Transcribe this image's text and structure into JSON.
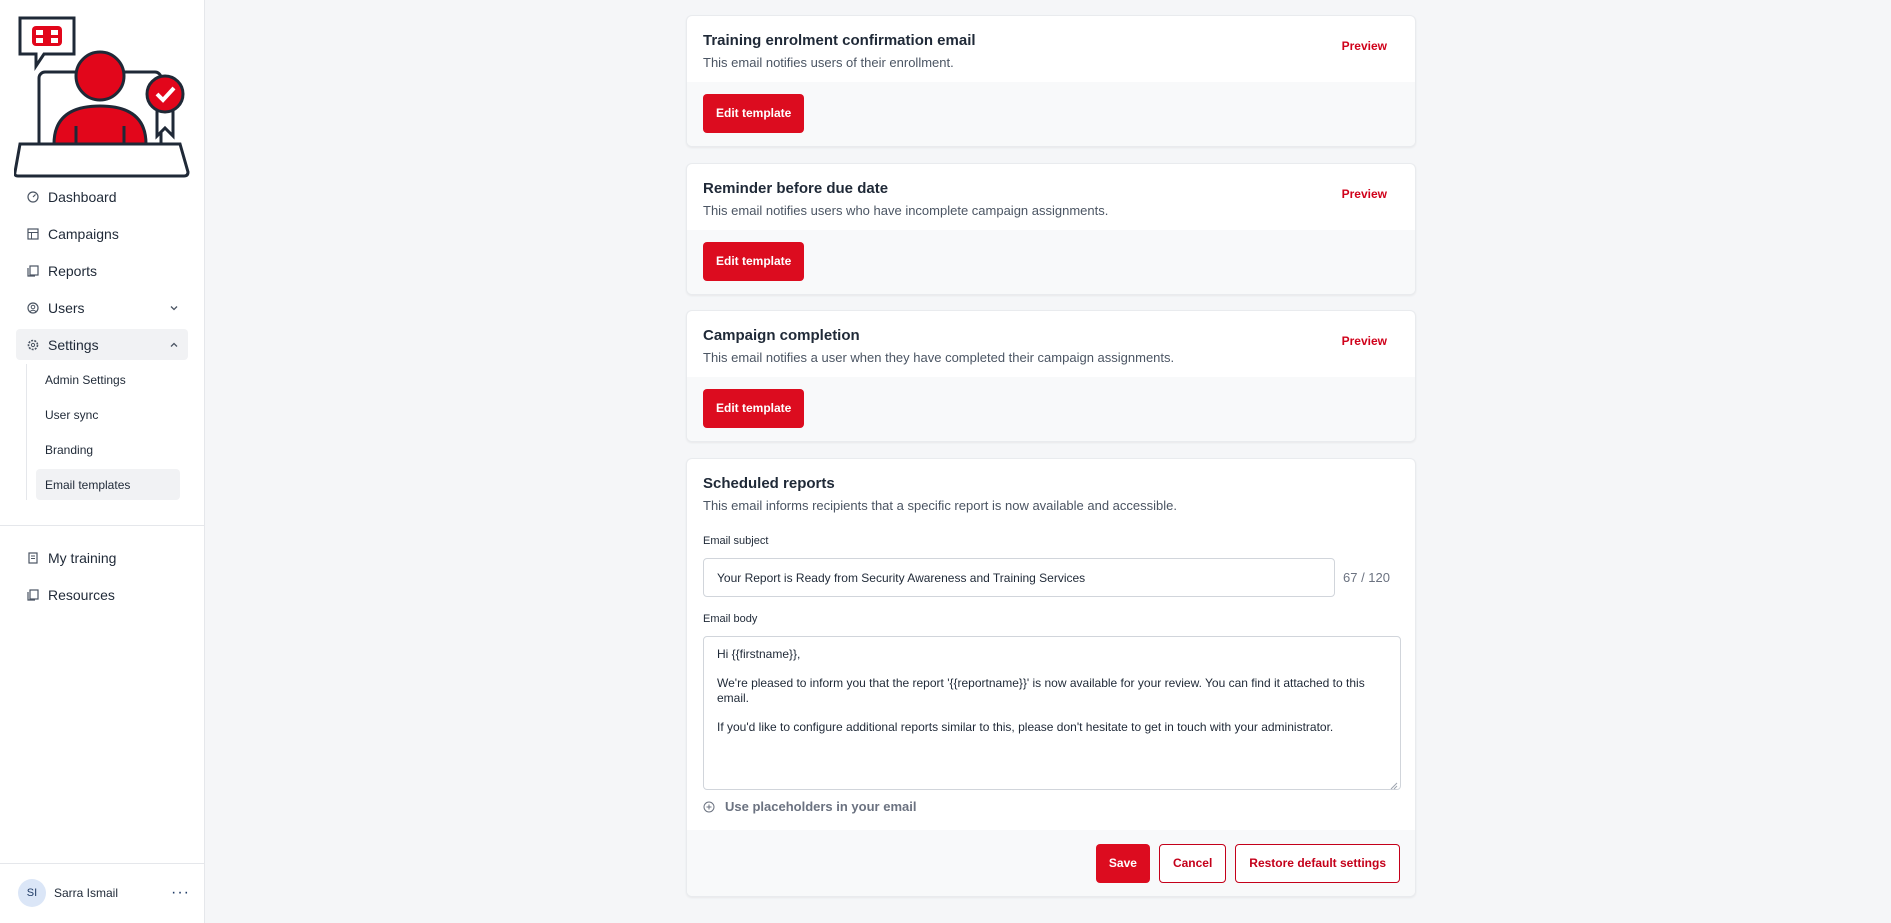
{
  "sidebar": {
    "nav": [
      {
        "label": "Dashboard",
        "icon": "dashboard-icon"
      },
      {
        "label": "Campaigns",
        "icon": "campaigns-icon"
      },
      {
        "label": "Reports",
        "icon": "reports-icon"
      },
      {
        "label": "Users",
        "icon": "users-icon"
      },
      {
        "label": "Settings",
        "icon": "gear-icon"
      }
    ],
    "settings_sub": [
      {
        "label": "Admin Settings"
      },
      {
        "label": "User sync"
      },
      {
        "label": "Branding"
      },
      {
        "label": "Email templates"
      }
    ],
    "nav2": [
      {
        "label": "My training",
        "icon": "training-icon"
      },
      {
        "label": "Resources",
        "icon": "resources-icon"
      }
    ],
    "user": {
      "initials": "SI",
      "name": "Sarra Ismail",
      "menu": "···"
    }
  },
  "cards": [
    {
      "title": "Training enrolment confirmation email",
      "desc": "This email notifies users of their enrollment.",
      "preview": "Preview",
      "edit": "Edit template"
    },
    {
      "title": "Reminder before due date",
      "desc": "This email notifies users who have incomplete campaign assignments.",
      "preview": "Preview",
      "edit": "Edit template"
    },
    {
      "title": "Campaign completion",
      "desc": "This email notifies a user when they have completed their campaign assignments.",
      "preview": "Preview",
      "edit": "Edit template"
    }
  ],
  "scheduled": {
    "title": "Scheduled reports",
    "desc": "This email informs recipients that a specific report is now available and accessible.",
    "subject_label": "Email subject",
    "subject_value": "Your Report is Ready from Security Awareness and Training Services",
    "counter": "67 / 120",
    "body_label": "Email body",
    "body_lines": [
      "Hi {{firstname}},",
      "We're pleased to inform you that the report '{{reportname}}' is now available for your review. You can find it attached to this email.",
      "If you'd like to configure additional reports similar to this, please don't hesitate to get in touch with your administrator."
    ],
    "placeholders_label": "Use placeholders in your email",
    "save": "Save",
    "cancel": "Cancel",
    "restore": "Restore default settings"
  },
  "colors": {
    "accent": "#dc0c1f",
    "active_bg": "#f1f2f4"
  }
}
